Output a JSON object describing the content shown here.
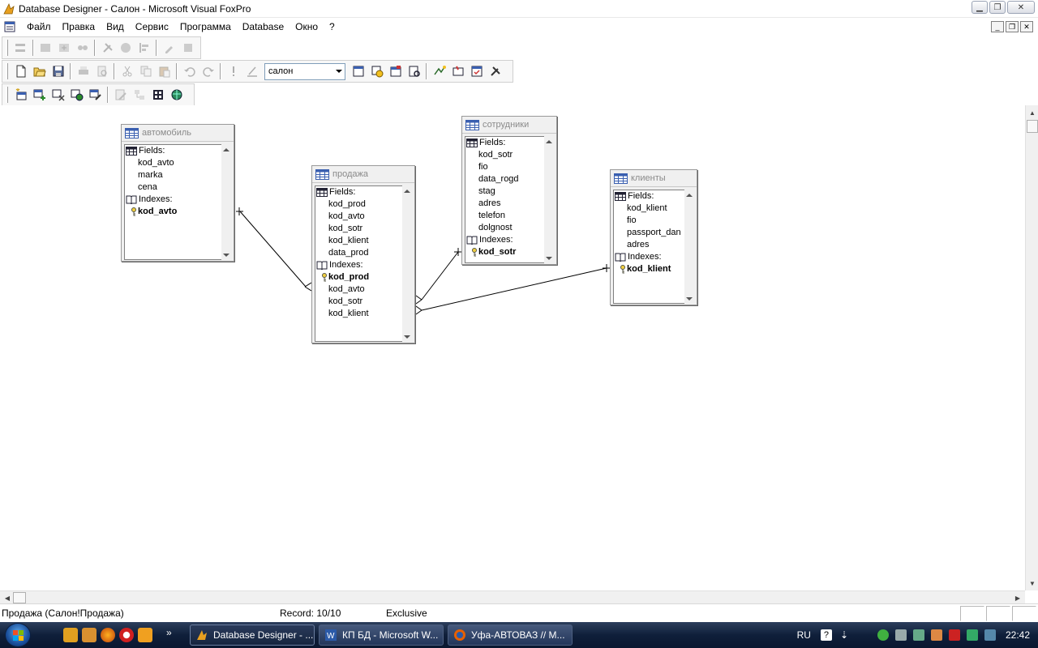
{
  "window": {
    "title": "Database Designer - Салон - Microsoft Visual FoxPro",
    "controls": [
      "minimize-icon",
      "restore-icon",
      "close-icon"
    ]
  },
  "menubar": {
    "items": [
      "Файл",
      "Правка",
      "Вид",
      "Сервис",
      "Программа",
      "Database",
      "Окно",
      "?"
    ]
  },
  "toolbar_standard": {
    "database_combo": "салон"
  },
  "tables": {
    "avtomobil": {
      "title": "автомобиль",
      "fields_label": "Fields:",
      "fields": [
        "kod_avto",
        "marka",
        "cena"
      ],
      "indexes_label": "Indexes:",
      "primary_key": "kod_avto",
      "indexes": []
    },
    "prodazha": {
      "title": "продажа",
      "fields_label": "Fields:",
      "fields": [
        "kod_prod",
        "kod_avto",
        "kod_sotr",
        "kod_klient",
        "data_prod"
      ],
      "indexes_label": "Indexes:",
      "primary_key": "kod_prod",
      "indexes": [
        "kod_avto",
        "kod_sotr",
        "kod_klient"
      ]
    },
    "sotrudniki": {
      "title": "сотрудники",
      "fields_label": "Fields:",
      "fields": [
        "kod_sotr",
        "fio",
        "data_rogd",
        "stag",
        "adres",
        "telefon",
        "dolgnost"
      ],
      "indexes_label": "Indexes:",
      "primary_key": "kod_sotr",
      "indexes": []
    },
    "klienty": {
      "title": "клиенты",
      "fields_label": "Fields:",
      "fields": [
        "kod_klient",
        "fio",
        "passport_dan",
        "adres"
      ],
      "indexes_label": "Indexes:",
      "primary_key": "kod_klient",
      "indexes": []
    }
  },
  "statusbar": {
    "alias": "Продажа (Салон!Продажа)",
    "record": "Record: 10/10",
    "mode": "Exclusive"
  },
  "taskbar": {
    "tasks": [
      "Database Designer - ...",
      "КП БД - Microsoft W...",
      "Уфа-АВТОВАЗ // М..."
    ],
    "language": "RU",
    "clock": "22:42"
  },
  "colors": {
    "taskbar": "#0f1f3a",
    "table_header_text": "#8a8a8a",
    "table_icon": "#3a5fb0"
  }
}
